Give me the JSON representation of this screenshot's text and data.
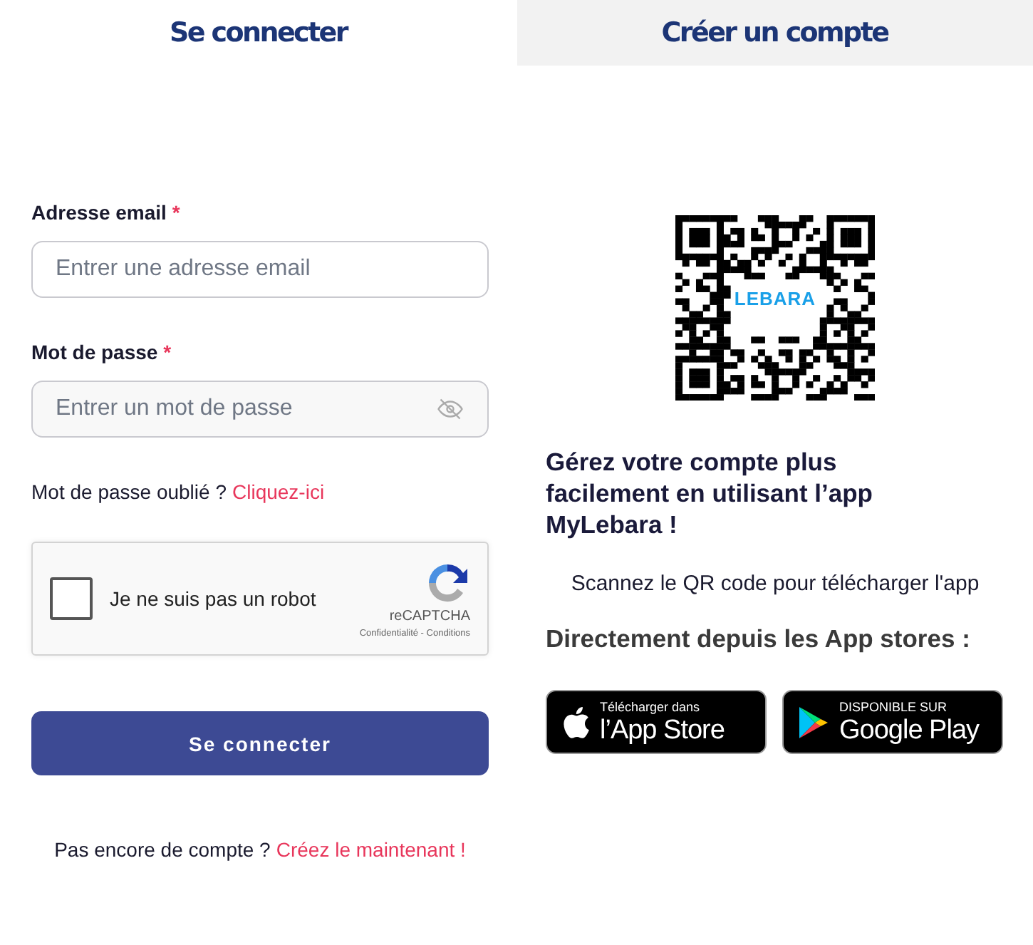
{
  "tabs": [
    {
      "label": "Se connecter",
      "selected": true
    },
    {
      "label": "Créer un compte",
      "selected": false
    }
  ],
  "login_form": {
    "fields": [
      {
        "label": "Adresse email",
        "required_mark": "*",
        "placeholder": "Entrer une adresse email",
        "kind": "text"
      },
      {
        "label": "Mot de passe",
        "required_mark": "*",
        "placeholder": "Entrer un mot de passe",
        "kind": "password"
      }
    ],
    "forgot": {
      "text": "Mot de passe oublié ?",
      "link": "Cliquez-ici"
    },
    "captcha": {
      "label": "Je ne suis pas un robot",
      "checked": false,
      "brand": "reCAPTCHA",
      "terms": "Confidentialité - Conditions"
    },
    "submit": "Se connecter",
    "signup": {
      "text": "Pas encore de compte ?",
      "link": "Créez le maintenant !"
    }
  },
  "app_promo": {
    "qr_logo": "LEBARA",
    "heading": "Gérez votre compte plus facilement en utilisant l’app MyLebara !",
    "scan_text": "Scannez le QR code pour télécharger l'app",
    "stores_heading": "Directement depuis les App stores :",
    "stores": [
      {
        "kind": "apple",
        "small": "Télécharger dans",
        "big": "l’App Store"
      },
      {
        "kind": "google",
        "small": "DISPONIBLE SUR",
        "big": "Google Play"
      }
    ]
  }
}
